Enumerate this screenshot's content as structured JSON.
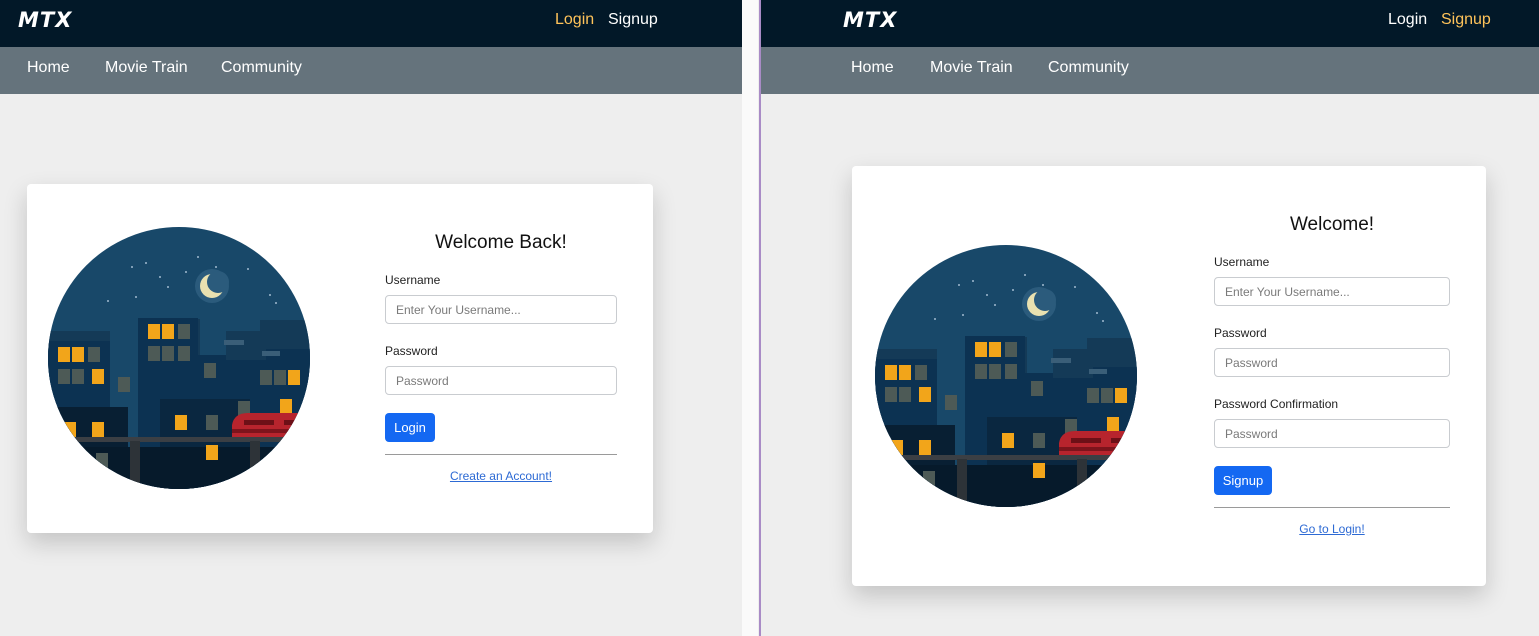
{
  "colors": {
    "topbar_bg": "#021828",
    "navbar_bg": "#65737c",
    "page_bg": "#eeeeee",
    "accent_link": "#ffc35a",
    "primary_button": "#1468f2",
    "link": "#2d6ad4"
  },
  "login_page": {
    "brand": "MTX",
    "auth": {
      "login": "Login",
      "signup": "Signup",
      "active": "login"
    },
    "nav": {
      "home": "Home",
      "movie_train": "Movie Train",
      "community": "Community"
    },
    "form": {
      "title": "Welcome Back!",
      "username_label": "Username",
      "username_placeholder": "Enter Your Username...",
      "password_label": "Password",
      "password_placeholder": "Password",
      "submit": "Login",
      "alt_link": "Create an Account!"
    }
  },
  "signup_page": {
    "brand": "MTX",
    "auth": {
      "login": "Login",
      "signup": "Signup",
      "active": "signup"
    },
    "nav": {
      "home": "Home",
      "movie_train": "Movie Train",
      "community": "Community"
    },
    "form": {
      "title": "Welcome!",
      "username_label": "Username",
      "username_placeholder": "Enter Your Username...",
      "password_label": "Password",
      "password_placeholder": "Password",
      "confirm_label": "Password Confirmation",
      "confirm_placeholder": "Password",
      "submit": "Signup",
      "alt_link": "Go to Login!"
    }
  },
  "illustration": {
    "icon": "night-city-train-illustration"
  }
}
